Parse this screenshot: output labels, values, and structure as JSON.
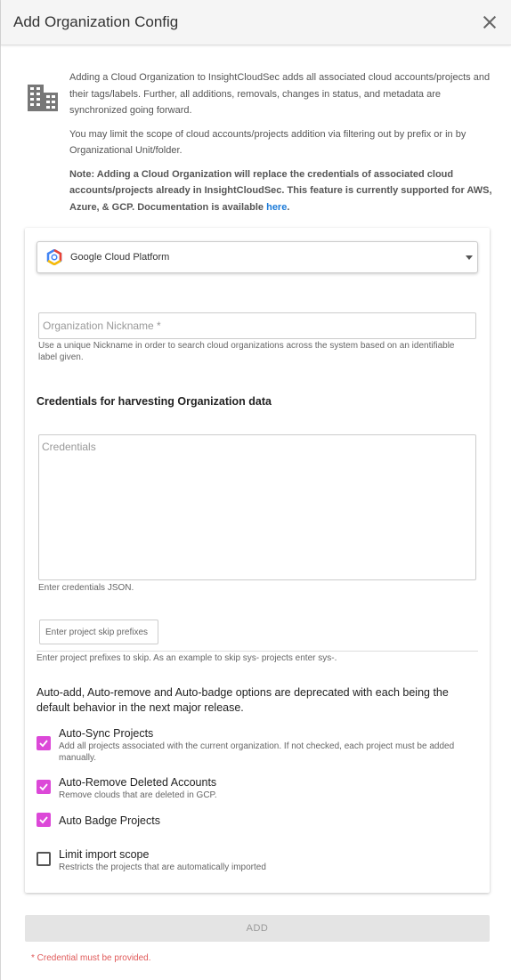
{
  "header": {
    "title": "Add Organization Config"
  },
  "intro": {
    "paragraph1": "Adding a Cloud Organization to InsightCloudSec adds all associated cloud accounts/projects and their tags/labels. Further, all additions, removals, changes in status, and metadata are synchronized going forward.",
    "paragraph2": "You may limit the scope of cloud accounts/projects addition via filtering out by prefix or in by Organizational Unit/folder.",
    "note": "Note: Adding a Cloud Organization will replace the credentials of associated cloud accounts/projects already in InsightCloudSec. This feature is currently supported for AWS, Azure, & GCP. Documentation is available ",
    "link_text": "here",
    "note_end": "."
  },
  "form": {
    "provider": {
      "selected": "Google Cloud Platform",
      "icon": "gcp-icon"
    },
    "nickname": {
      "placeholder": "Organization Nickname *",
      "value": "",
      "helper": "Use a unique Nickname in order to search cloud organizations across the system based on an identifiable label given."
    },
    "credentials_title": "Credentials for harvesting Organization data",
    "credentials": {
      "placeholder": "Credentials",
      "value": "",
      "helper": "Enter credentials JSON."
    },
    "skip_prefixes": {
      "placeholder": "Enter project skip prefixes",
      "helper": "Enter project prefixes to skip. As an example to skip sys- projects enter sys-."
    },
    "deprecation_note": "Auto-add, Auto-remove and Auto-badge options are deprecated with each being the default behavior in the next major release.",
    "options": [
      {
        "label": "Auto-Sync Projects",
        "description": "Add all projects associated with the current organization. If not checked, each project must be added manually.",
        "checked": true
      },
      {
        "label": "Auto-Remove Deleted Accounts",
        "description": "Remove clouds that are deleted in GCP.",
        "checked": true
      },
      {
        "label": "Auto Badge Projects",
        "description": "",
        "checked": true
      },
      {
        "label": "Limit import scope",
        "description": "Restricts the projects that are automatically imported",
        "checked": false
      }
    ]
  },
  "footer": {
    "add_label": "ADD",
    "error": "* Credential must be provided."
  },
  "colors": {
    "accent": "#dc48d8",
    "link": "#1a7ad8",
    "error": "#e05a5a"
  }
}
